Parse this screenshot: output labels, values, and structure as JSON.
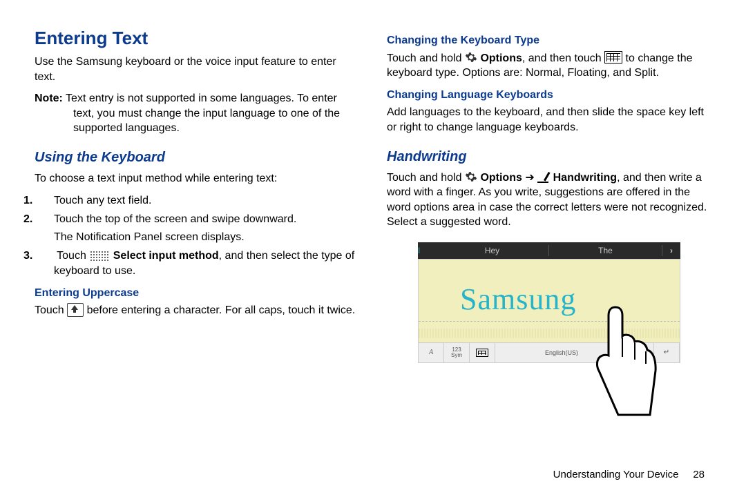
{
  "left": {
    "title": "Entering Text",
    "intro": "Use the Samsung keyboard or the voice input feature to enter text.",
    "note_label": "Note:",
    "note_body": "Text entry is not supported in some languages. To enter text, you must change the input language to one of the supported languages.",
    "h2_using": "Using the Keyboard",
    "using_intro": "To choose a text input method while entering text:",
    "steps": {
      "s1": "Touch any text field.",
      "s2a": "Touch the top of the screen and swipe downward.",
      "s2b": "The Notification Panel screen displays.",
      "s3a": " Touch ",
      "s3b_bold": "Select input method",
      "s3c": ", and then select the type of keyboard to use."
    },
    "h3_upper": "Entering Uppercase",
    "upper_a": "Touch ",
    "upper_b": " before entering a character. For all caps, touch it twice."
  },
  "right": {
    "h3_type": "Changing the Keyboard Type",
    "type_a": "Touch and hold ",
    "type_opt": "Options",
    "type_b": ", and then touch ",
    "type_c": " to change the keyboard type. Options are: Normal, Floating, and Split.",
    "h3_lang": "Changing Language Keyboards",
    "lang_body": "Add languages to the keyboard, and then slide the space key left or right to change language keyboards.",
    "h2_hand": "Handwriting",
    "hand_a": "Touch and hold ",
    "hand_opt": "Options",
    "hand_arrow": " ➔ ",
    "hand_hw": "Handwriting",
    "hand_b": ", and then write a word with a finger. As you write, suggestions are offered in the word options area in case the correct letters were not recognized. Select a suggested word.",
    "figure": {
      "sugg1": "I",
      "sugg2": "Hey",
      "sugg3": "The",
      "chevron": "›",
      "word": "Samsung",
      "key_font": "A",
      "key_sym_top": "123",
      "key_sym_bot": "Sym",
      "space_label": "English(US)",
      "enter": "↵"
    }
  },
  "footer": {
    "section": "Understanding Your Device",
    "page": "28"
  }
}
